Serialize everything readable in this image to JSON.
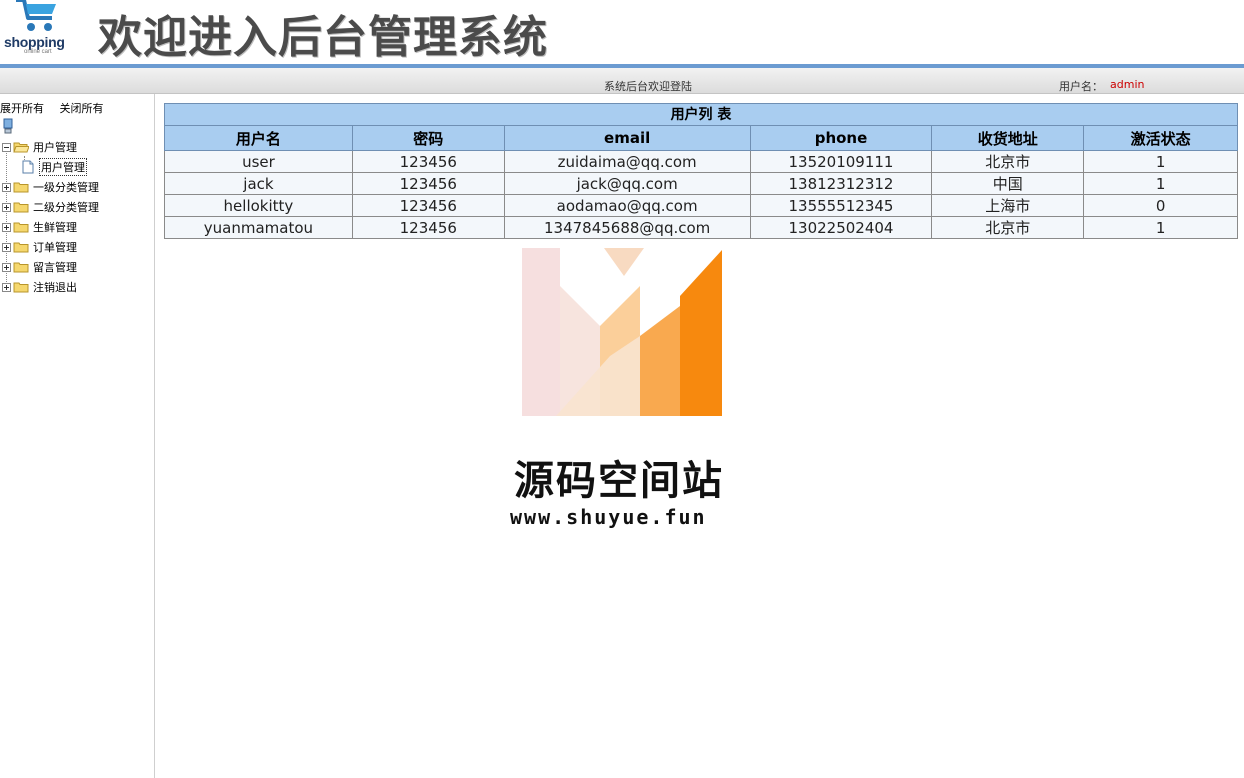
{
  "header": {
    "logo_word": "shopping",
    "logo_sub": "online cart",
    "title": "欢迎进入后台管理系统"
  },
  "topbar": {
    "welcome": "系统后台欢迎登陆",
    "user_label": "用户名：",
    "user_value": "admin"
  },
  "sidebar": {
    "expand_all": "展开所有",
    "collapse_all": "关闭所有",
    "items": [
      {
        "label": "用户管理",
        "expanded": true,
        "children": [
          {
            "label": "用户管理"
          }
        ]
      },
      {
        "label": "一级分类管理",
        "expanded": false
      },
      {
        "label": "二级分类管理",
        "expanded": false
      },
      {
        "label": "生鲜管理",
        "expanded": false
      },
      {
        "label": "订单管理",
        "expanded": false
      },
      {
        "label": "留言管理",
        "expanded": false
      },
      {
        "label": "注销退出",
        "expanded": false
      }
    ]
  },
  "table": {
    "caption": "用户列 表",
    "headers": [
      "用户名",
      "密码",
      "email",
      "phone",
      "收货地址",
      "激活状态"
    ],
    "rows": [
      [
        "user",
        "123456",
        "zuidaima@qq.com",
        "13520109111",
        "北京市",
        "1"
      ],
      [
        "jack",
        "123456",
        "jack@qq.com",
        "13812312312",
        "中国",
        "1"
      ],
      [
        "hellokitty",
        "123456",
        "aodamao@qq.com",
        "13555512345",
        "上海市",
        "0"
      ],
      [
        "yuanmamatou",
        "123456",
        "1347845688@qq.com",
        "13022502404",
        "北京市",
        "1"
      ]
    ]
  },
  "watermark": {
    "title": "源码空间站",
    "url": "www.shuyue.fun"
  },
  "colors": {
    "accent": "#6b9bd1",
    "table_header": "#a9cdf0",
    "user_value": "#cc0000",
    "watermark_orange": "#f7890e"
  }
}
